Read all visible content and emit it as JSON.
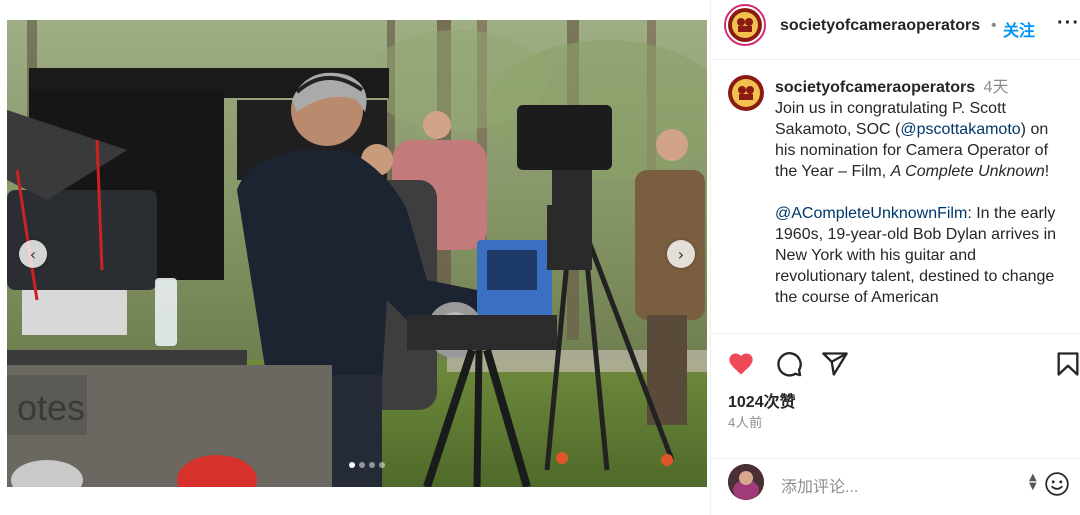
{
  "post": {
    "media": {
      "slide_index": 1,
      "slide_count": 4,
      "prev_icon": "chevron-left-icon",
      "next_icon": "chevron-right-icon",
      "prev_glyph": "‹",
      "next_glyph": "›",
      "image_alt_text_visible": "",
      "watermark": ""
    },
    "header": {
      "username": "societyofcameraoperators",
      "separator": "•",
      "follow_label": "关注",
      "more_glyph": "···"
    },
    "caption": {
      "username": "societyofcameraoperators",
      "time": "4天",
      "p1_a": "Join us in congratulating P. Scott Sakamoto, SOC (",
      "p1_mention": "@pscottakamoto",
      "p1_b": ") on his nomination for Camera Operator of the Year – Film, ",
      "p1_title": "A Complete Unknown",
      "p1_end": "!",
      "p2_mention": "@ACompleteUnknownFilm",
      "p2_text": ": In the early 1960s, 19-year-old Bob Dylan arrives in New York with his guitar and revolutionary talent, destined to change the course of American"
    },
    "actions": {
      "like_icon": "heart-filled-icon",
      "comment_icon": "comment-icon",
      "share_icon": "send-icon",
      "save_icon": "bookmark-icon",
      "like_color": "#ed4956"
    },
    "likes_text": "1024次赞",
    "time_ago": "4人前",
    "comment": {
      "placeholder": "添加评论...",
      "emoji_icon": "emoji-smile-icon"
    }
  },
  "colors": {
    "accent": "#0095f6",
    "text": "#262626",
    "muted": "#8e8e8e",
    "mention": "#00376b",
    "border": "#efefef"
  }
}
